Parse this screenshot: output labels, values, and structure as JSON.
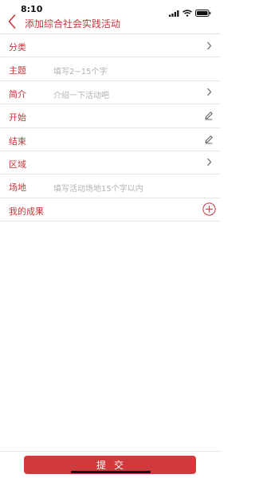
{
  "status_bar": {
    "time": "8:10",
    "icons": [
      "signal-icon",
      "wifi-icon",
      "battery-icon"
    ]
  },
  "nav": {
    "title": "添加综合社会实践活动",
    "back_icon": "chevron-left-icon"
  },
  "form": {
    "rows": [
      {
        "label": "分类",
        "placeholder": "",
        "accessory": "chevron-right-icon"
      },
      {
        "label": "主题",
        "placeholder": "填写2~15个字",
        "accessory": ""
      },
      {
        "label": "简介",
        "placeholder": "介绍一下活动吧",
        "accessory": "chevron-right-icon"
      },
      {
        "label": "开始",
        "placeholder": "",
        "accessory": "pencil-icon"
      },
      {
        "label": "结束",
        "placeholder": "",
        "accessory": "pencil-icon"
      },
      {
        "label": "区域",
        "placeholder": "",
        "accessory": "chevron-right-icon"
      },
      {
        "label": "场地",
        "placeholder": "填写活动场地15个字以内",
        "accessory": ""
      },
      {
        "label": "我的成果",
        "placeholder": "",
        "accessory": "plus-circle-icon"
      }
    ]
  },
  "submit": {
    "label": "提交"
  },
  "colors": {
    "accent": "#c8363a",
    "button": "#d03a3c",
    "placeholder": "#b2b2b2",
    "divider": "#e6e6e6"
  }
}
